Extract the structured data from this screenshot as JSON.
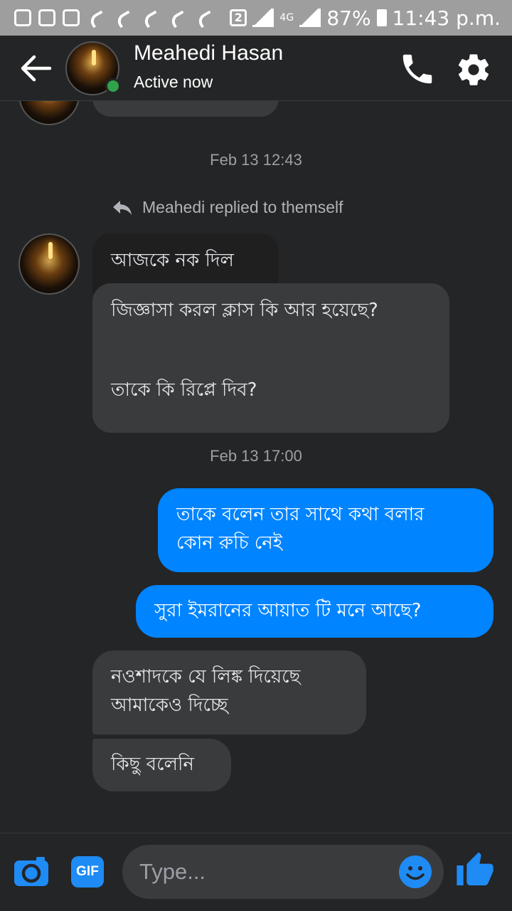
{
  "statusbar": {
    "notification_badge": "2",
    "network": "4G",
    "battery": "87%",
    "time": "11:43 p.m."
  },
  "header": {
    "name": "Meahedi Hasan",
    "status": "Active now"
  },
  "chat": {
    "timestamp_1": "Feb 13 12:43",
    "reply_note": "Meahedi replied to themself",
    "quoted_message": "আজকে নক দিল",
    "reply_message_line1": "জিজ্ঞাসা করল ক্লাস কি আর হয়েছে?",
    "reply_message_line2": "তাকে কি রিপ্লে দিব?",
    "timestamp_2": "Feb 13 17:00",
    "sent_1_line1": "তাকে বলেন তার সাথে কথা বলার",
    "sent_1_line2": "কোন রুচি নেই",
    "sent_2": "সুরা ইমরানের আয়াত টি মনে আছে?",
    "recv_1_line1": "নওশাদকে যে লিঙ্ক দিয়েছে",
    "recv_1_line2": "আমাকেও দিচ্ছে",
    "recv_2": "কিছু বলেনি"
  },
  "composer": {
    "gif_label": "GIF",
    "placeholder": "Type..."
  },
  "icons": [
    "back-arrow-icon",
    "phone-icon",
    "gear-icon",
    "reply-icon",
    "camera-icon",
    "gif-icon",
    "emoji-icon",
    "thumbs-up-icon"
  ],
  "colors": {
    "background": "#242526",
    "incoming_bubble": "#3a3b3c",
    "outgoing_bubble": "#0084ff",
    "accent": "#1f8bf5",
    "online": "#31a24c"
  }
}
